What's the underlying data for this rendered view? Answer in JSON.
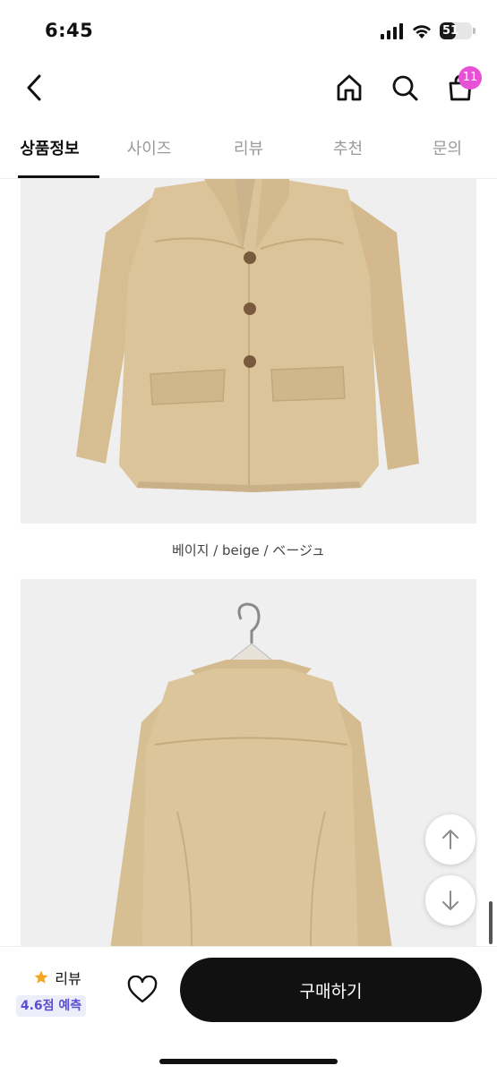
{
  "status_bar": {
    "time": "6:45",
    "battery": "51"
  },
  "nav": {
    "cart_count": "11"
  },
  "tabs": [
    {
      "label": "상품정보",
      "active": true
    },
    {
      "label": "사이즈",
      "active": false
    },
    {
      "label": "리뷰",
      "active": false
    },
    {
      "label": "추천",
      "active": false
    },
    {
      "label": "문의",
      "active": false
    }
  ],
  "product": {
    "color_caption": "베이지 / beige / ベージュ",
    "garment_color": "#d9c197"
  },
  "bottom_bar": {
    "review_label": "리뷰",
    "review_score": "4.6점 예측",
    "buy_label": "구매하기"
  },
  "colors": {
    "accent_badge": "#e651d6",
    "review_score_bg": "#eeeefb",
    "review_score_text": "#5a4fd1",
    "buy_button": "#111111"
  }
}
